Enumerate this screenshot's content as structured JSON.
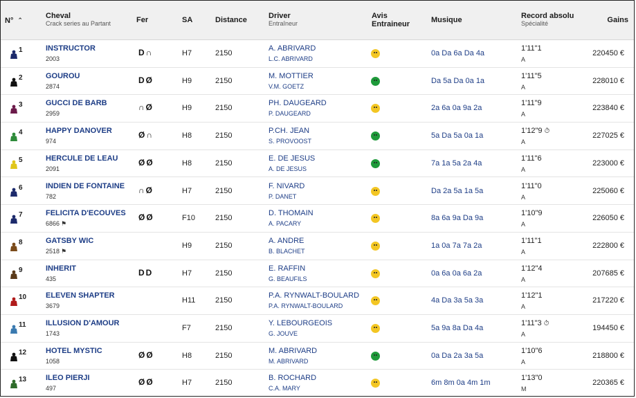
{
  "header": {
    "num": "N°",
    "sort_icon": "chevron-up",
    "cheval": "Cheval",
    "cheval_sub": "Crack series au Partant",
    "fer": "Fer",
    "sa": "SA",
    "distance": "Distance",
    "driver": "Driver",
    "driver_sub": "Entraîneur",
    "avis_1": "Avis",
    "avis_2": "Entraineur",
    "musique": "Musique",
    "record": "Record absolu",
    "record_sub": "Spécialité",
    "gains": "Gains"
  },
  "colors": {
    "link_blue": "#1d3d86",
    "avis_yellow": "#f3c623",
    "avis_green": "#1e9a3a"
  },
  "rows": [
    {
      "num": "1",
      "name": "INSTRUCTOR",
      "sub": "2003",
      "tag": "",
      "fer": [
        "D",
        "∩"
      ],
      "sa": "H7",
      "distance": "2150",
      "driver": "A. ABRIVARD",
      "trainer": "L.C. ABRIVARD",
      "avis": "yellow",
      "musique": "0a  Da  6a  Da  4a",
      "record": "1'11\"1",
      "clock": "",
      "spec": "A",
      "gains": "220450 €",
      "jockey": "#1c2a6b"
    },
    {
      "num": "2",
      "name": "GOUROU",
      "sub": "2874",
      "tag": "",
      "fer": [
        "D",
        "Ø"
      ],
      "sa": "H9",
      "distance": "2150",
      "driver": "M. MOTTIER",
      "trainer": "V.M. GOETZ",
      "avis": "green",
      "musique": "Da  5a  Da  0a  1a",
      "record": "1'11\"5",
      "clock": "",
      "spec": "A",
      "gains": "228010 €",
      "jockey": "#111111"
    },
    {
      "num": "3",
      "name": "GUCCI DE BARB",
      "sub": "2959",
      "tag": "",
      "fer": [
        "∩",
        "Ø"
      ],
      "sa": "H9",
      "distance": "2150",
      "driver": "PH. DAUGEARD",
      "trainer": "P. DAUGEARD",
      "avis": "yellow",
      "musique": "2a  6a  0a  9a  2a",
      "record": "1'11\"9",
      "clock": "",
      "spec": "A",
      "gains": "223840 €",
      "jockey": "#6b1a4a"
    },
    {
      "num": "4",
      "name": "HAPPY DANOVER",
      "sub": "974",
      "tag": "",
      "fer": [
        "Ø",
        "∩"
      ],
      "sa": "H8",
      "distance": "2150",
      "driver": "P.CH. JEAN",
      "trainer": "S. PROVOOST",
      "avis": "green",
      "musique": "5a  Da  5a  0a  1a",
      "record": "1'12\"9",
      "clock": "⏱",
      "spec": "A",
      "gains": "227025 €",
      "jockey": "#2e8b3a"
    },
    {
      "num": "5",
      "name": "HERCULE DE LEAU",
      "sub": "2091",
      "tag": "",
      "fer": [
        "Ø",
        "Ø"
      ],
      "sa": "H8",
      "distance": "2150",
      "driver": "E. DE JESUS",
      "trainer": "A. DE JESUS",
      "avis": "green",
      "musique": "7a  1a  5a  2a  4a",
      "record": "1'11\"6",
      "clock": "",
      "spec": "A",
      "gains": "223000 €",
      "jockey": "#e0c61a"
    },
    {
      "num": "6",
      "name": "INDIEN DE FONTAINE",
      "sub": "782",
      "tag": "",
      "fer": [
        "∩",
        "Ø"
      ],
      "sa": "H7",
      "distance": "2150",
      "driver": "F. NIVARD",
      "trainer": "P. DANET",
      "avis": "yellow",
      "musique": "Da  2a  5a  1a  5a",
      "record": "1'11\"0",
      "clock": "",
      "spec": "A",
      "gains": "225060 €",
      "jockey": "#1c2a6b"
    },
    {
      "num": "7",
      "name": "FELICITA D'ECOUVES",
      "sub": "6866",
      "tag": "⚑",
      "fer": [
        "Ø",
        "Ø"
      ],
      "sa": "F10",
      "distance": "2150",
      "driver": "D. THOMAIN",
      "trainer": "A. PACARY",
      "avis": "yellow",
      "musique": "8a  6a  9a  Da  9a",
      "record": "1'10\"9",
      "clock": "",
      "spec": "A",
      "gains": "226050 €",
      "jockey": "#1c2a6b"
    },
    {
      "num": "8",
      "name": "GATSBY WIC",
      "sub": "2518",
      "tag": "⚑",
      "fer": [],
      "sa": "H9",
      "distance": "2150",
      "driver": "A. ANDRE",
      "trainer": "B. BLACHET",
      "avis": "yellow",
      "musique": "1a  0a  7a  7a  2a",
      "record": "1'11\"1",
      "clock": "",
      "spec": "A",
      "gains": "222800 €",
      "jockey": "#7a4a1a"
    },
    {
      "num": "9",
      "name": "INHERIT",
      "sub": "435",
      "tag": "",
      "fer": [
        "D",
        "D"
      ],
      "sa": "H7",
      "distance": "2150",
      "driver": "E. RAFFIN",
      "trainer": "G. BEAUFILS",
      "avis": "yellow",
      "musique": "0a  6a  0a  6a  2a",
      "record": "1'12\"4",
      "clock": "",
      "spec": "A",
      "gains": "207685 €",
      "jockey": "#5a3a1a"
    },
    {
      "num": "10",
      "name": "ELEVEN SHAPTER",
      "sub": "3679",
      "tag": "",
      "fer": [],
      "sa": "H11",
      "distance": "2150",
      "driver": "P.A. RYNWALT-BOULARD",
      "trainer": "P.A. RYNWALT-BOULARD",
      "avis": "yellow",
      "musique": "4a  Da  3a  5a  3a",
      "record": "1'12\"1",
      "clock": "",
      "spec": "A",
      "gains": "217220 €",
      "jockey": "#b01a1a"
    },
    {
      "num": "11",
      "name": "ILLUSION D'AMOUR",
      "sub": "1743",
      "tag": "",
      "fer": [],
      "sa": "F7",
      "distance": "2150",
      "driver": "Y. LEBOURGEOIS",
      "trainer": "G. JOUVE",
      "avis": "yellow",
      "musique": "5a  9a  8a  Da  4a",
      "record": "1'11\"3",
      "clock": "⏱",
      "spec": "A",
      "gains": "194450 €",
      "jockey": "#3a7ab0"
    },
    {
      "num": "12",
      "name": "HOTEL MYSTIC",
      "sub": "1058",
      "tag": "",
      "fer": [
        "Ø",
        "Ø"
      ],
      "sa": "H8",
      "distance": "2150",
      "driver": "M. ABRIVARD",
      "trainer": "M. ABRIVARD",
      "avis": "green",
      "musique": "0a  Da  2a  3a  5a",
      "record": "1'10\"6",
      "clock": "",
      "spec": "A",
      "gains": "218800 €",
      "jockey": "#111111"
    },
    {
      "num": "13",
      "name": "ILEO PIERJI",
      "sub": "497",
      "tag": "",
      "fer": [
        "Ø",
        "Ø"
      ],
      "sa": "H7",
      "distance": "2150",
      "driver": "B. ROCHARD",
      "trainer": "C.A. MARY",
      "avis": "yellow",
      "musique": "6m  8m  0a  4m  1m",
      "record": "1'13\"0",
      "clock": "",
      "spec": "M",
      "gains": "220365 €",
      "jockey": "#2e6b2a"
    }
  ]
}
